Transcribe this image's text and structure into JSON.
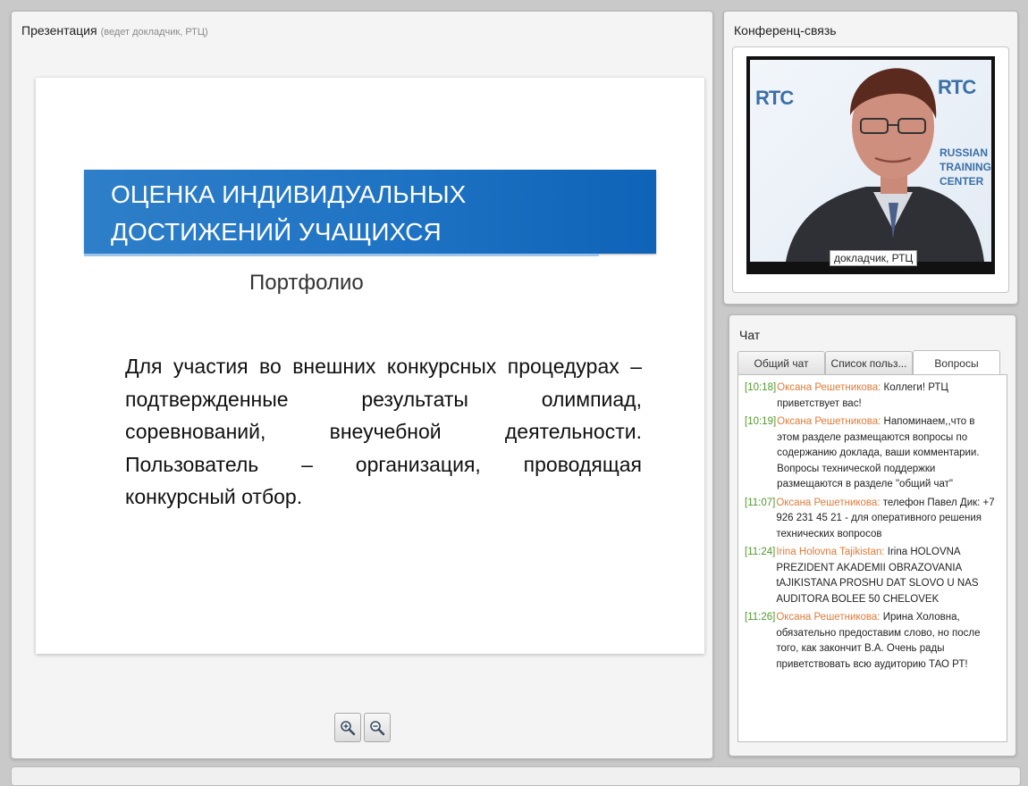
{
  "presentation": {
    "title": "Презентация",
    "subtitle": "(ведет докладчик,  РТЦ)",
    "slide": {
      "title": "ОЦЕНКА ИНДИВИДУАЛЬНЫХ ДОСТИЖЕНИЙ УЧАЩИХСЯ",
      "subtitle": "Портфолио",
      "body": "Для участия во внешних конкурсных процедурах – подтвержденные результаты олимпиад, соревнований, внеучебной деятельности. Пользователь – организация, проводящая конкурсный отбор."
    },
    "zoom_in_icon": "zoom-in-icon",
    "zoom_out_icon": "zoom-out-icon"
  },
  "conference": {
    "title": "Конференц-связь",
    "video_caption": "докладчик,  РТЦ",
    "backdrop": {
      "logo": "RTC",
      "text_lines": [
        "RUSSIAN",
        "TRAINING",
        "CENTER"
      ]
    }
  },
  "chat": {
    "title": "Чат",
    "tabs": [
      {
        "label": "Общий чат",
        "active": false
      },
      {
        "label": "Список польз...",
        "active": false
      },
      {
        "label": "Вопросы",
        "active": true
      }
    ],
    "messages": [
      {
        "time": "[10:18]",
        "author": "Оксана Решетникова:",
        "text": "Коллеги! РТЦ приветствует вас!"
      },
      {
        "time": "[10:19]",
        "author": "Оксана Решетникова:",
        "text": "Напоминаем,,что в этом разделе размещаются вопросы по содержанию доклада, ваши комментарии. Вопросы технической поддержки размещаются в разделе \"общий чат\""
      },
      {
        "time": "[11:07]",
        "author": "Оксана Решетникова:",
        "text": "телефон Павел  Дик: +7 926 231 45 21 - для оперативного решения технических вопросов"
      },
      {
        "time": "[11:24]",
        "author": "Irina Holovna Tajikistan:",
        "text": "Irina HOLOVNA PREZIDENT AKADEMII OBRAZOVANIA tAJIKISTANA PROSHU DAT SLOVO U NAS AUDITORA BOLEE 50 CHELOVEK"
      },
      {
        "time": "[11:26]",
        "author": "Оксана Решетникова:",
        "text": "Ирина Холовна, обязательно предоставим слово, но после того, как закончит В.А. Очень рады приветствовать всю аудиторию ТАО РТ!"
      }
    ]
  },
  "colors": {
    "slide_banner": "#1f73c4",
    "chat_time": "#4f9a2b",
    "chat_author": "#e07b39"
  }
}
